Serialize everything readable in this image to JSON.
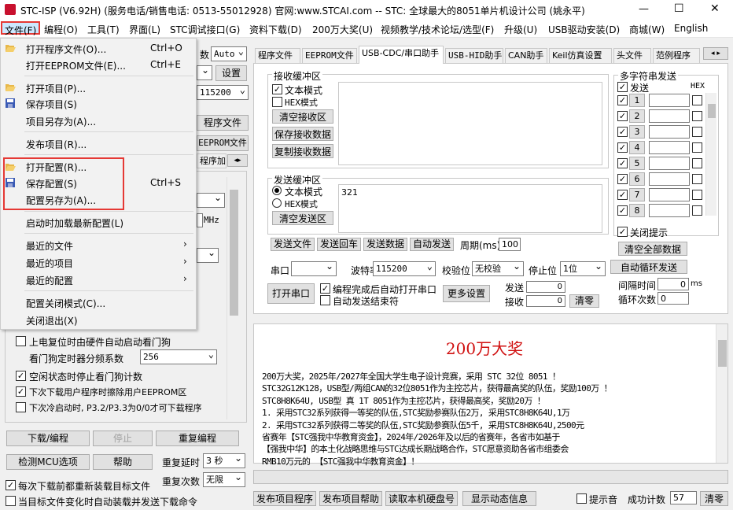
{
  "window": {
    "title": "STC-ISP (V6.92H) (服务电话/销售电话: 0513-55012928) 官网:www.STCAI.com  -- STC: 全球最大的8051单片机设计公司 (姚永平)",
    "minimize": "—",
    "maximize": "☐",
    "close": "✕"
  },
  "menu": [
    "文件(F)",
    "编程(O)",
    "工具(T)",
    "界面(L)",
    "STC调试接口(G)",
    "资料下载(D)",
    "200万大奖(U)",
    "视频教学/技术论坛/选型(F)",
    "升级(U)",
    "USB驱动安装(D)",
    "商城(W)",
    "English"
  ],
  "file_menu": {
    "items": [
      {
        "label": "打开程序文件(O)...",
        "shortcut": "Ctrl+O",
        "icon": "folder-open-icon"
      },
      {
        "label": "打开EEPROM文件(E)...",
        "shortcut": "Ctrl+E"
      },
      {
        "label": "打开项目(P)...",
        "icon": "folder-open-icon"
      },
      {
        "label": "保存项目(S)",
        "icon": "floppy-disk-icon"
      },
      {
        "label": "项目另存为(A)..."
      },
      {
        "label": "发布项目(R)..."
      },
      {
        "label": "打开配置(R)...",
        "icon": "folder-open-icon"
      },
      {
        "label": "保存配置(S)",
        "shortcut": "Ctrl+S",
        "icon": "floppy-disk-icon"
      },
      {
        "label": "配置另存为(A)..."
      },
      {
        "label": "启动时加载最新配置(L)"
      },
      {
        "label": "最近的文件"
      },
      {
        "label": "最近的项目"
      },
      {
        "label": "最近的配置"
      },
      {
        "label": "配置关闭模式(C)..."
      },
      {
        "label": "关闭退出(X)"
      }
    ],
    "arrow": "›"
  },
  "left": {
    "baud_label": "数",
    "baud_value": "Auto",
    "settings": "设置",
    "baud2": "115200",
    "open_prog": "程序文件",
    "open_eeprom": "EEPROM文件",
    "prog_tab": "程序加",
    "mhz": "MHz",
    "opt1": "上电复位时由硬件自动启动看门狗",
    "wdt_label": "看门狗定时器分频系数",
    "wdt_value": "256",
    "opt2": "空闲状态时停止看门狗计数",
    "opt3": "下次下载用户程序时擦除用户EEPROM区",
    "opt4": "下次冷启动时, P3.2/P3.3为0/0才可下载程序",
    "download": "下载/编程",
    "stop": "停止",
    "reprogram": "重复编程",
    "detect": "检测MCU选项",
    "help": "帮助",
    "delay_label": "重复延时",
    "delay_value": "3 秒",
    "count_label": "重复次数",
    "count_value": "无限",
    "reload": "每次下载前都重新装载目标文件",
    "auto_send": "当目标文件变化时自动装载并发送下载命令"
  },
  "tabs": [
    "程序文件",
    "EEPROM文件",
    "USB-CDC/串口助手",
    "USB-HID助手",
    "CAN助手",
    "Keil仿真设置",
    "头文件",
    "范例程序"
  ],
  "serial": {
    "recv_title": "接收缓冲区",
    "text_mode": "文本模式",
    "hex_mode": "HEX模式",
    "clear_recv": "清空接收区",
    "save_recv": "保存接收数据",
    "copy_recv": "复制接收数据",
    "send_title": "发送缓冲区",
    "send_text": "321",
    "clear_send": "清空发送区",
    "send_file": "发送文件",
    "send_return": "发送回车",
    "send_data": "发送数据",
    "auto_send": "自动发送",
    "period_label": "周期(ms)",
    "period_value": "100",
    "port_label": "串口",
    "baud_label": "波特率",
    "baud_value": "115200",
    "parity_label": "校验位",
    "parity_value": "无校验",
    "stop_label": "停止位",
    "stop_value": "1位",
    "open_port": "打开串口",
    "auto_open": "编程完成后自动打开串口",
    "auto_end": "自动发送结束符",
    "more": "更多设置",
    "sent_label": "发送",
    "sent_value": "0",
    "recv_label": "接收",
    "recv_value": "0",
    "clear": "清零"
  },
  "multi": {
    "title": "多字符串发送",
    "send": "发送",
    "hex": "HEX",
    "rows": [
      "1",
      "2",
      "3",
      "4",
      "5",
      "6",
      "7",
      "8"
    ],
    "close_hint": "关闭提示",
    "clear_all": "清空全部数据",
    "auto_loop": "自动循环发送",
    "interval_label": "间隔时间",
    "interval_value": "0",
    "ms": "ms",
    "loop_label": "循环次数",
    "loop_value": "0"
  },
  "info": {
    "title": "200万大奖",
    "lines": [
      "200万大奖，2025年/2027年全国大学生电子设计竞赛，采用 STC 32位 8051 ！",
      "STC32G12K128，USB型/两组CAN的32位8051作为主控芯片，获得最高奖的队伍，奖励100万 ！",
      "STC8H8K64U, USB型 真 1T 8051作为主控芯片，获得最高奖，奖励20万 ！",
      "1. 采用STC32系列获得一等奖的队伍,STC奖励参赛队伍2万, 采用STC8H8K64U,1万",
      "2. 采用STC32系列获得二等奖的队伍,STC奖励参赛队伍5千, 采用STC8H8K64U,2500元",
      "省赛年【STC强我中华教育资金】，2024年/2026年及以后的省赛年，各省市如基于",
      "【强我中华】的本土化战略思维与STC达成长期战略合作，STC愿意资助各省市组委会",
      "RMB10万元的 【STC强我中华教育资金】！"
    ]
  },
  "bottom": {
    "publish_prog": "发布项目程序",
    "publish_help": "发布项目帮助",
    "read_disk": "读取本机硬盘号",
    "show_dyn": "显示动态信息",
    "hint": "提示音",
    "success_label": "成功计数",
    "success_value": "57",
    "clear": "清零"
  }
}
